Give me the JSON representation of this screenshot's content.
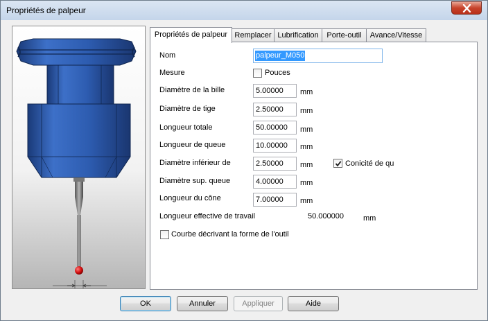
{
  "window": {
    "title": "Propriétés de palpeur"
  },
  "tabs": [
    {
      "label": "Propriétés de palpeur"
    },
    {
      "label": "Remplacer"
    },
    {
      "label": "Lubrification"
    },
    {
      "label": "Porte-outil"
    },
    {
      "label": "Avance/Vitesse"
    }
  ],
  "form": {
    "name": {
      "label": "Nom",
      "value": "palpeur_M050"
    },
    "measure": {
      "label": "Mesure",
      "checkbox_label": "Pouces",
      "checked": false
    },
    "ball_diameter": {
      "label": "Diamètre de la bille",
      "value": "5.00000",
      "unit": "mm"
    },
    "shank_diameter": {
      "label": "Diamètre de tige",
      "value": "2.50000",
      "unit": "mm"
    },
    "total_length": {
      "label": "Longueur totale",
      "value": "50.00000",
      "unit": "mm"
    },
    "tail_length": {
      "label": "Longueur de queue",
      "value": "10.00000",
      "unit": "mm"
    },
    "lower_diameter": {
      "label": "Diamètre inférieur de",
      "value": "2.50000",
      "unit": "mm"
    },
    "taper": {
      "label": "Conicité de que",
      "checked": true
    },
    "upper_diameter": {
      "label": "Diamètre sup. queue",
      "value": "4.00000",
      "unit": "mm"
    },
    "cone_length": {
      "label": "Longueur du cône",
      "value": "7.00000",
      "unit": "mm"
    },
    "effective_length": {
      "label": "Longueur effective de travail",
      "value": "50.000000",
      "unit": "mm"
    },
    "curve": {
      "label": "Courbe décrivant la forme de l'outil",
      "checked": false
    }
  },
  "buttons": {
    "ok": "OK",
    "cancel": "Annuler",
    "apply": "Appliquer",
    "help": "Aide"
  },
  "colors": {
    "probe_body": "#2f5fb0",
    "probe_dark": "#1c3d7a",
    "ball": "#d01010",
    "selection": "#3399ff"
  }
}
